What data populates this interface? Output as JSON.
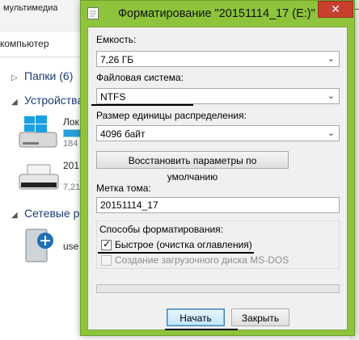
{
  "explorer": {
    "top_menu": "мультимедиа",
    "address": "компьютер",
    "sections": [
      {
        "label": "Папки (6)"
      },
      {
        "label": "Устройства"
      },
      {
        "label": "Сетевые р"
      }
    ],
    "drives": [
      {
        "label": "Лок",
        "sub": "184"
      },
      {
        "label": "201",
        "sub": "7,21"
      }
    ],
    "network": [
      {
        "label": "use"
      }
    ]
  },
  "dialog": {
    "title": "Форматирование \"20151114_17 (E:)\"",
    "close_glyph": "✕",
    "capacity": {
      "label": "Емкость:",
      "value": "7,26 ГБ"
    },
    "filesystem": {
      "label": "Файловая система:",
      "value": "NTFS"
    },
    "cluster": {
      "label": "Размер единицы распределения:",
      "value": "4096 байт"
    },
    "restore_defaults": "Восстановить параметры по умолчанию",
    "volume_label": {
      "label": "Метка тома:",
      "value": "20151114_17"
    },
    "format_options": {
      "label": "Способы форматирования:",
      "quick": {
        "label": "Быстрое (очистка оглавления)",
        "checked": true
      },
      "msdos": {
        "label": "Создание загрузочного диска MS-DOS",
        "checked": false,
        "enabled": false
      }
    },
    "progress": 0,
    "start_button": "Начать",
    "close_button": "Закрыть"
  },
  "colors": {
    "dialog_frame": "#8dc43c",
    "close_button": "#c7402e",
    "client_bg": "#f0f0f0"
  }
}
